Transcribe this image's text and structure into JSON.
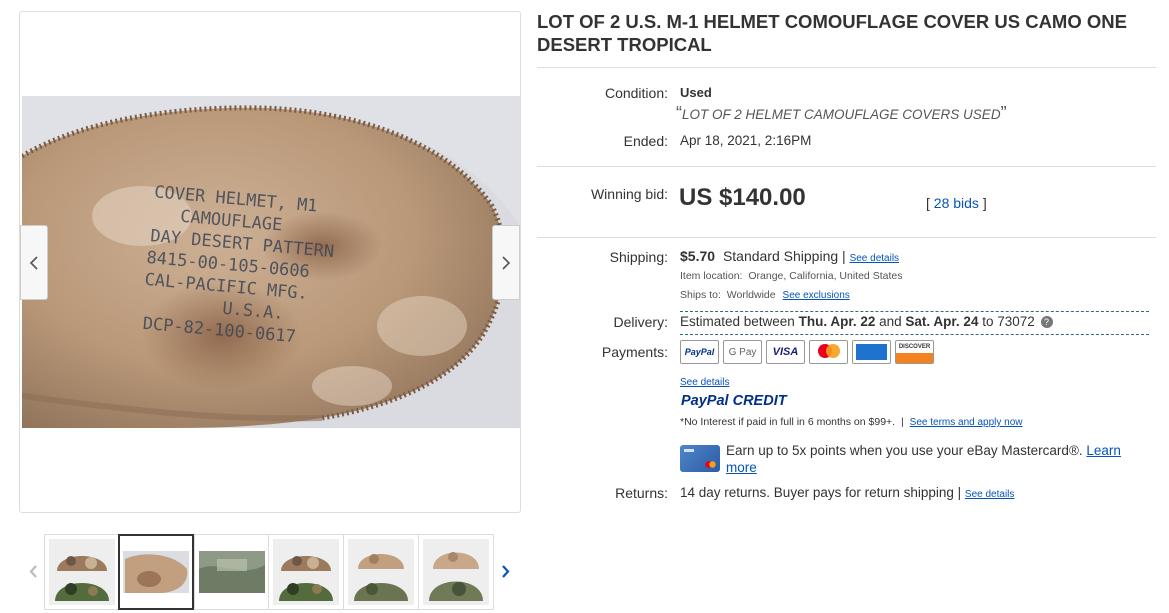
{
  "listing": {
    "title": "LOT OF 2 U.S. M-1 HELMET COMOUFLAGE COVER US CAMO ONE DESERT TROPICAL"
  },
  "condition": {
    "label": "Condition:",
    "value": "Used",
    "note": "LOT OF 2 HELMET CAMOUFLAGE COVERS USED"
  },
  "ended": {
    "label": "Ended:",
    "value": "Apr 18, 2021, 2:16PM"
  },
  "bid": {
    "label": "Winning bid:",
    "price": "US $140.00",
    "bids_link": "28 bids",
    "bracket_open": "[",
    "bracket_close": "]"
  },
  "shipping": {
    "label": "Shipping:",
    "cost": "$5.70",
    "method": "Standard Shipping |",
    "details_link": "See details",
    "location_label": "Item location:",
    "location_value": "Orange, California, United States",
    "ships_to_label": "Ships to:",
    "ships_to_value": "Worldwide",
    "exclusions_link": "See exclusions"
  },
  "delivery": {
    "label": "Delivery:",
    "prefix": "Estimated between",
    "start": "Thu. Apr. 22",
    "and": "and",
    "end": "Sat. Apr. 24",
    "to": "to 73072"
  },
  "payments": {
    "label": "Payments:",
    "methods": [
      "PayPal",
      "G Pay",
      "VISA",
      "Mastercard",
      "American Express",
      "DISCOVER"
    ],
    "details_link": "See details",
    "paypal_credit_pay": "PayPal",
    "paypal_credit_word": "CREDIT",
    "credit_note": "*No Interest if paid in full in 6 months on $99+.",
    "credit_sep": "|",
    "terms_link": "See terms and apply now",
    "mastercard_offer": "Earn up to 5x points when you use your eBay Mastercard®.",
    "learn_more_link": "Learn more"
  },
  "returns": {
    "label": "Returns:",
    "value": "14 day returns. Buyer pays for return shipping |",
    "details_link": "See details"
  },
  "photo": {
    "stamp_lines": [
      "COVER HELMET, M1",
      "CAMOUFLAGE",
      "DAY DESERT PATTERN",
      "8415-00-105-0606",
      "CAL-PACIFIC MFG.",
      "U.S.A.",
      "DCP-82-100-0617"
    ]
  },
  "thumbnails": {
    "count": 6,
    "active_index": 1
  },
  "colors": {
    "link": "#0654ba",
    "text": "#333333",
    "border": "#dddddd",
    "fabric": "#c2a07f",
    "ink": "#3d4655"
  }
}
